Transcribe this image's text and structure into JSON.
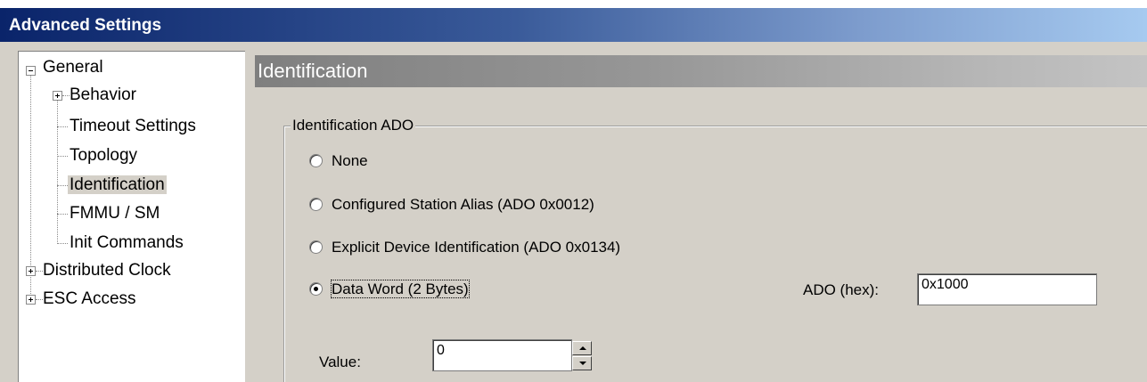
{
  "window": {
    "title": "Advanced Settings"
  },
  "tree": {
    "items": [
      {
        "label": "General",
        "expander": "minus"
      },
      {
        "label": "Behavior",
        "expander": "plus"
      },
      {
        "label": "Timeout Settings"
      },
      {
        "label": "Topology"
      },
      {
        "label": "Identification",
        "selected": true
      },
      {
        "label": "FMMU / SM"
      },
      {
        "label": "Init Commands"
      },
      {
        "label": "Distributed Clock",
        "expander": "plus"
      },
      {
        "label": "ESC Access",
        "expander": "plus"
      }
    ]
  },
  "section": {
    "title": "Identification"
  },
  "group": {
    "title": "Identification ADO",
    "options": [
      {
        "label": "None",
        "checked": false
      },
      {
        "label": "Configured Station Alias (ADO 0x0012)",
        "checked": false
      },
      {
        "label": "Explicit Device Identification (ADO 0x0134)",
        "checked": false
      },
      {
        "label": "Data Word (2 Bytes)",
        "checked": true
      }
    ],
    "ado_label": "ADO (hex):",
    "ado_value": "0x1000",
    "value_label": "Value:",
    "value": "0"
  }
}
